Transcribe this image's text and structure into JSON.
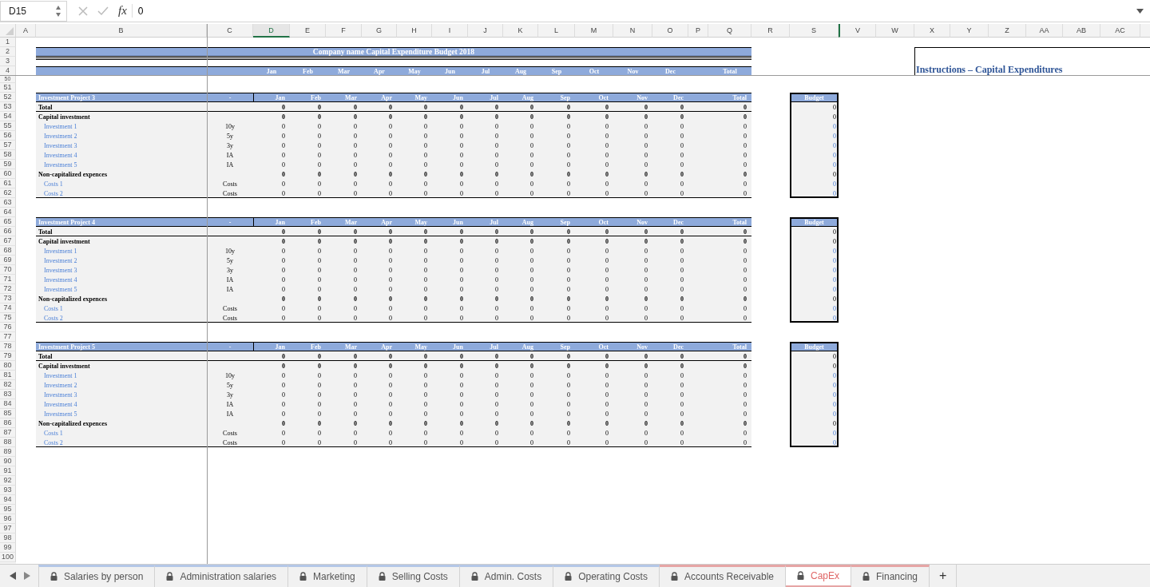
{
  "formula_bar": {
    "name_box": "D15",
    "fx": "fx",
    "formula": "0"
  },
  "column_headers": [
    {
      "label": "A",
      "selected": false
    },
    {
      "label": "B",
      "selected": false
    },
    {
      "label": "C",
      "selected": false
    },
    {
      "label": "D",
      "selected": true
    },
    {
      "label": "E",
      "selected": false
    },
    {
      "label": "F",
      "selected": false
    },
    {
      "label": "G",
      "selected": false
    },
    {
      "label": "H",
      "selected": false
    },
    {
      "label": "I",
      "selected": false
    },
    {
      "label": "J",
      "selected": false
    },
    {
      "label": "K",
      "selected": false
    },
    {
      "label": "L",
      "selected": false
    },
    {
      "label": "M",
      "selected": false
    },
    {
      "label": "N",
      "selected": false
    },
    {
      "label": "O",
      "selected": false
    },
    {
      "label": "P",
      "selected": false
    },
    {
      "label": "Q",
      "selected": false
    },
    {
      "label": "R",
      "selected": false
    },
    {
      "label": "S",
      "selected": false
    },
    {
      "label": "V",
      "selected": false,
      "after_hidden": true
    },
    {
      "label": "W",
      "selected": false
    },
    {
      "label": "X",
      "selected": false
    },
    {
      "label": "Y",
      "selected": false
    },
    {
      "label": "Z",
      "selected": false
    },
    {
      "label": "AA",
      "selected": false
    },
    {
      "label": "AB",
      "selected": false
    },
    {
      "label": "AC",
      "selected": false
    }
  ],
  "instructions": {
    "title": "Instructions – Capital Expenditures"
  },
  "rows": [
    {
      "number": "1"
    },
    {
      "number": "2",
      "kind": "title",
      "text": "Company name Capital Expenditure Budget 2018"
    },
    {
      "number": "3",
      "kind": "double_rule"
    },
    {
      "number": "4",
      "kind": "month_header",
      "months": [
        "Jan",
        "Feb",
        "Mar",
        "Apr",
        "May",
        "Jun",
        "Jul",
        "Aug",
        "Sep",
        "Oct",
        "Nov",
        "Dec"
      ],
      "total": "Total"
    },
    {
      "number": "50",
      "kind": "partial"
    },
    {
      "number": "51"
    },
    {
      "number": "52",
      "kind": "project_header",
      "label": "Investment Project 3",
      "code": "-",
      "months": [
        "Jan",
        "Feb",
        "Mar",
        "Apr",
        "May",
        "Jun",
        "Jul",
        "Aug",
        "Sep",
        "Oct",
        "Nov",
        "Dec"
      ],
      "total": "Total",
      "budget": "Budget"
    },
    {
      "number": "53",
      "kind": "total",
      "label": "Total",
      "values": [
        "0",
        "0",
        "0",
        "0",
        "0",
        "0",
        "0",
        "0",
        "0",
        "0",
        "0",
        "0"
      ],
      "total": "0",
      "budget": "0"
    },
    {
      "number": "54",
      "kind": "section",
      "label": "Capital investment",
      "values": [
        "0",
        "0",
        "0",
        "0",
        "0",
        "0",
        "0",
        "0",
        "0",
        "0",
        "0",
        "0"
      ],
      "total": "0",
      "budget": "0"
    },
    {
      "number": "55",
      "kind": "item",
      "label": "Investment 1",
      "type": "10y",
      "values": [
        "0",
        "0",
        "0",
        "0",
        "0",
        "0",
        "0",
        "0",
        "0",
        "0",
        "0",
        "0"
      ],
      "total": "0",
      "budget": "0"
    },
    {
      "number": "56",
      "kind": "item",
      "label": "Investment 2",
      "type": "5y",
      "values": [
        "0",
        "0",
        "0",
        "0",
        "0",
        "0",
        "0",
        "0",
        "0",
        "0",
        "0",
        "0"
      ],
      "total": "0",
      "budget": "0"
    },
    {
      "number": "57",
      "kind": "item",
      "label": "Investment 3",
      "type": "3y",
      "values": [
        "0",
        "0",
        "0",
        "0",
        "0",
        "0",
        "0",
        "0",
        "0",
        "0",
        "0",
        "0"
      ],
      "total": "0",
      "budget": "0"
    },
    {
      "number": "58",
      "kind": "item",
      "label": "Investment 4",
      "type": "IA",
      "values": [
        "0",
        "0",
        "0",
        "0",
        "0",
        "0",
        "0",
        "0",
        "0",
        "0",
        "0",
        "0"
      ],
      "total": "0",
      "budget": "0"
    },
    {
      "number": "59",
      "kind": "item",
      "label": "Investment 5",
      "type": "IA",
      "values": [
        "0",
        "0",
        "0",
        "0",
        "0",
        "0",
        "0",
        "0",
        "0",
        "0",
        "0",
        "0"
      ],
      "total": "0",
      "budget": "0"
    },
    {
      "number": "60",
      "kind": "section",
      "label": "Non-capitalized expences",
      "values": [
        "0",
        "0",
        "0",
        "0",
        "0",
        "0",
        "0",
        "0",
        "0",
        "0",
        "0",
        "0"
      ],
      "total": "0",
      "budget": "0"
    },
    {
      "number": "61",
      "kind": "item",
      "label": "Costs 1",
      "type": "Costs",
      "values": [
        "0",
        "0",
        "0",
        "0",
        "0",
        "0",
        "0",
        "0",
        "0",
        "0",
        "0",
        "0"
      ],
      "total": "0",
      "budget": "0"
    },
    {
      "number": "62",
      "kind": "item",
      "label": "Costs 2",
      "type": "Costs",
      "values": [
        "0",
        "0",
        "0",
        "0",
        "0",
        "0",
        "0",
        "0",
        "0",
        "0",
        "0",
        "0"
      ],
      "total": "0",
      "budget": "0"
    },
    {
      "number": "63"
    },
    {
      "number": "64"
    },
    {
      "number": "65",
      "kind": "project_header",
      "label": "Investment Project 4",
      "code": "-",
      "months": [
        "Jan",
        "Feb",
        "Mar",
        "Apr",
        "May",
        "Jun",
        "Jul",
        "Aug",
        "Sep",
        "Oct",
        "Nov",
        "Dec"
      ],
      "total": "Total",
      "budget": "Budget"
    },
    {
      "number": "66",
      "kind": "total",
      "label": "Total",
      "values": [
        "0",
        "0",
        "0",
        "0",
        "0",
        "0",
        "0",
        "0",
        "0",
        "0",
        "0",
        "0"
      ],
      "total": "0",
      "budget": "0"
    },
    {
      "number": "67",
      "kind": "section",
      "label": "Capital investment",
      "values": [
        "0",
        "0",
        "0",
        "0",
        "0",
        "0",
        "0",
        "0",
        "0",
        "0",
        "0",
        "0"
      ],
      "total": "0",
      "budget": "0"
    },
    {
      "number": "68",
      "kind": "item",
      "label": "Investment 1",
      "type": "10y",
      "values": [
        "0",
        "0",
        "0",
        "0",
        "0",
        "0",
        "0",
        "0",
        "0",
        "0",
        "0",
        "0"
      ],
      "total": "0",
      "budget": "0"
    },
    {
      "number": "69",
      "kind": "item",
      "label": "Investment 2",
      "type": "5y",
      "values": [
        "0",
        "0",
        "0",
        "0",
        "0",
        "0",
        "0",
        "0",
        "0",
        "0",
        "0",
        "0"
      ],
      "total": "0",
      "budget": "0"
    },
    {
      "number": "70",
      "kind": "item",
      "label": "Investment 3",
      "type": "3y",
      "values": [
        "0",
        "0",
        "0",
        "0",
        "0",
        "0",
        "0",
        "0",
        "0",
        "0",
        "0",
        "0"
      ],
      "total": "0",
      "budget": "0"
    },
    {
      "number": "71",
      "kind": "item",
      "label": "Investment 4",
      "type": "IA",
      "values": [
        "0",
        "0",
        "0",
        "0",
        "0",
        "0",
        "0",
        "0",
        "0",
        "0",
        "0",
        "0"
      ],
      "total": "0",
      "budget": "0"
    },
    {
      "number": "72",
      "kind": "item",
      "label": "Investment 5",
      "type": "IA",
      "values": [
        "0",
        "0",
        "0",
        "0",
        "0",
        "0",
        "0",
        "0",
        "0",
        "0",
        "0",
        "0"
      ],
      "total": "0",
      "budget": "0"
    },
    {
      "number": "73",
      "kind": "section",
      "label": "Non-capitalized expences",
      "values": [
        "0",
        "0",
        "0",
        "0",
        "0",
        "0",
        "0",
        "0",
        "0",
        "0",
        "0",
        "0"
      ],
      "total": "0",
      "budget": "0"
    },
    {
      "number": "74",
      "kind": "item",
      "label": "Costs 1",
      "type": "Costs",
      "values": [
        "0",
        "0",
        "0",
        "0",
        "0",
        "0",
        "0",
        "0",
        "0",
        "0",
        "0",
        "0"
      ],
      "total": "0",
      "budget": "0"
    },
    {
      "number": "75",
      "kind": "item",
      "label": "Costs 2",
      "type": "Costs",
      "values": [
        "0",
        "0",
        "0",
        "0",
        "0",
        "0",
        "0",
        "0",
        "0",
        "0",
        "0",
        "0"
      ],
      "total": "0",
      "budget": "0"
    },
    {
      "number": "76"
    },
    {
      "number": "77"
    },
    {
      "number": "78",
      "kind": "project_header",
      "label": "Investment Project 5",
      "code": "-",
      "months": [
        "Jan",
        "Feb",
        "Mar",
        "Apr",
        "May",
        "Jun",
        "Jul",
        "Aug",
        "Sep",
        "Oct",
        "Nov",
        "Dec"
      ],
      "total": "Total",
      "budget": "Budget"
    },
    {
      "number": "79",
      "kind": "total",
      "label": "Total",
      "values": [
        "0",
        "0",
        "0",
        "0",
        "0",
        "0",
        "0",
        "0",
        "0",
        "0",
        "0",
        "0"
      ],
      "total": "0",
      "budget": "0"
    },
    {
      "number": "80",
      "kind": "section",
      "label": "Capital investment",
      "values": [
        "0",
        "0",
        "0",
        "0",
        "0",
        "0",
        "0",
        "0",
        "0",
        "0",
        "0",
        "0"
      ],
      "total": "0",
      "budget": "0"
    },
    {
      "number": "81",
      "kind": "item",
      "label": "Investment 1",
      "type": "10y",
      "values": [
        "0",
        "0",
        "0",
        "0",
        "0",
        "0",
        "0",
        "0",
        "0",
        "0",
        "0",
        "0"
      ],
      "total": "0",
      "budget": "0"
    },
    {
      "number": "82",
      "kind": "item",
      "label": "Investment 2",
      "type": "5y",
      "values": [
        "0",
        "0",
        "0",
        "0",
        "0",
        "0",
        "0",
        "0",
        "0",
        "0",
        "0",
        "0"
      ],
      "total": "0",
      "budget": "0"
    },
    {
      "number": "83",
      "kind": "item",
      "label": "Investment 3",
      "type": "3y",
      "values": [
        "0",
        "0",
        "0",
        "0",
        "0",
        "0",
        "0",
        "0",
        "0",
        "0",
        "0",
        "0"
      ],
      "total": "0",
      "budget": "0"
    },
    {
      "number": "84",
      "kind": "item",
      "label": "Investment 4",
      "type": "IA",
      "values": [
        "0",
        "0",
        "0",
        "0",
        "0",
        "0",
        "0",
        "0",
        "0",
        "0",
        "0",
        "0"
      ],
      "total": "0",
      "budget": "0"
    },
    {
      "number": "85",
      "kind": "item",
      "label": "Investment 5",
      "type": "IA",
      "values": [
        "0",
        "0",
        "0",
        "0",
        "0",
        "0",
        "0",
        "0",
        "0",
        "0",
        "0",
        "0"
      ],
      "total": "0",
      "budget": "0"
    },
    {
      "number": "86",
      "kind": "section",
      "label": "Non-capitalized expences",
      "values": [
        "0",
        "0",
        "0",
        "0",
        "0",
        "0",
        "0",
        "0",
        "0",
        "0",
        "0",
        "0"
      ],
      "total": "0",
      "budget": "0"
    },
    {
      "number": "87",
      "kind": "item",
      "label": "Costs 1",
      "type": "Costs",
      "values": [
        "0",
        "0",
        "0",
        "0",
        "0",
        "0",
        "0",
        "0",
        "0",
        "0",
        "0",
        "0"
      ],
      "total": "0",
      "budget": "0"
    },
    {
      "number": "88",
      "kind": "item",
      "label": "Costs 2",
      "type": "Costs",
      "values": [
        "0",
        "0",
        "0",
        "0",
        "0",
        "0",
        "0",
        "0",
        "0",
        "0",
        "0",
        "0"
      ],
      "total": "0",
      "budget": "0"
    },
    {
      "number": "89"
    },
    {
      "number": "90"
    },
    {
      "number": "91"
    },
    {
      "number": "92"
    },
    {
      "number": "93"
    },
    {
      "number": "94"
    },
    {
      "number": "95"
    },
    {
      "number": "96"
    },
    {
      "number": "97"
    },
    {
      "number": "98"
    },
    {
      "number": "99"
    },
    {
      "number": "100"
    }
  ],
  "sheet_tabs": [
    {
      "label": "Salaries by person",
      "selected": false,
      "color": "#b4c7e7"
    },
    {
      "label": "Administration salaries",
      "selected": false,
      "color": "#b4c7e7"
    },
    {
      "label": "Marketing",
      "selected": false,
      "color": "#b4c7e7"
    },
    {
      "label": "Selling Costs",
      "selected": false,
      "color": "#b4c7e7"
    },
    {
      "label": "Admin. Costs",
      "selected": false,
      "color": "#b4c7e7"
    },
    {
      "label": "Operating Costs",
      "selected": false,
      "color": "#b4c7e7"
    },
    {
      "label": "Accounts Receivable",
      "selected": false,
      "color": "#e6a5a5"
    },
    {
      "label": "CapEx",
      "selected": true,
      "color": "#e6a5a5"
    },
    {
      "label": "Financing",
      "selected": false,
      "color": "#e6a5a5"
    }
  ],
  "add_sheet": "+"
}
